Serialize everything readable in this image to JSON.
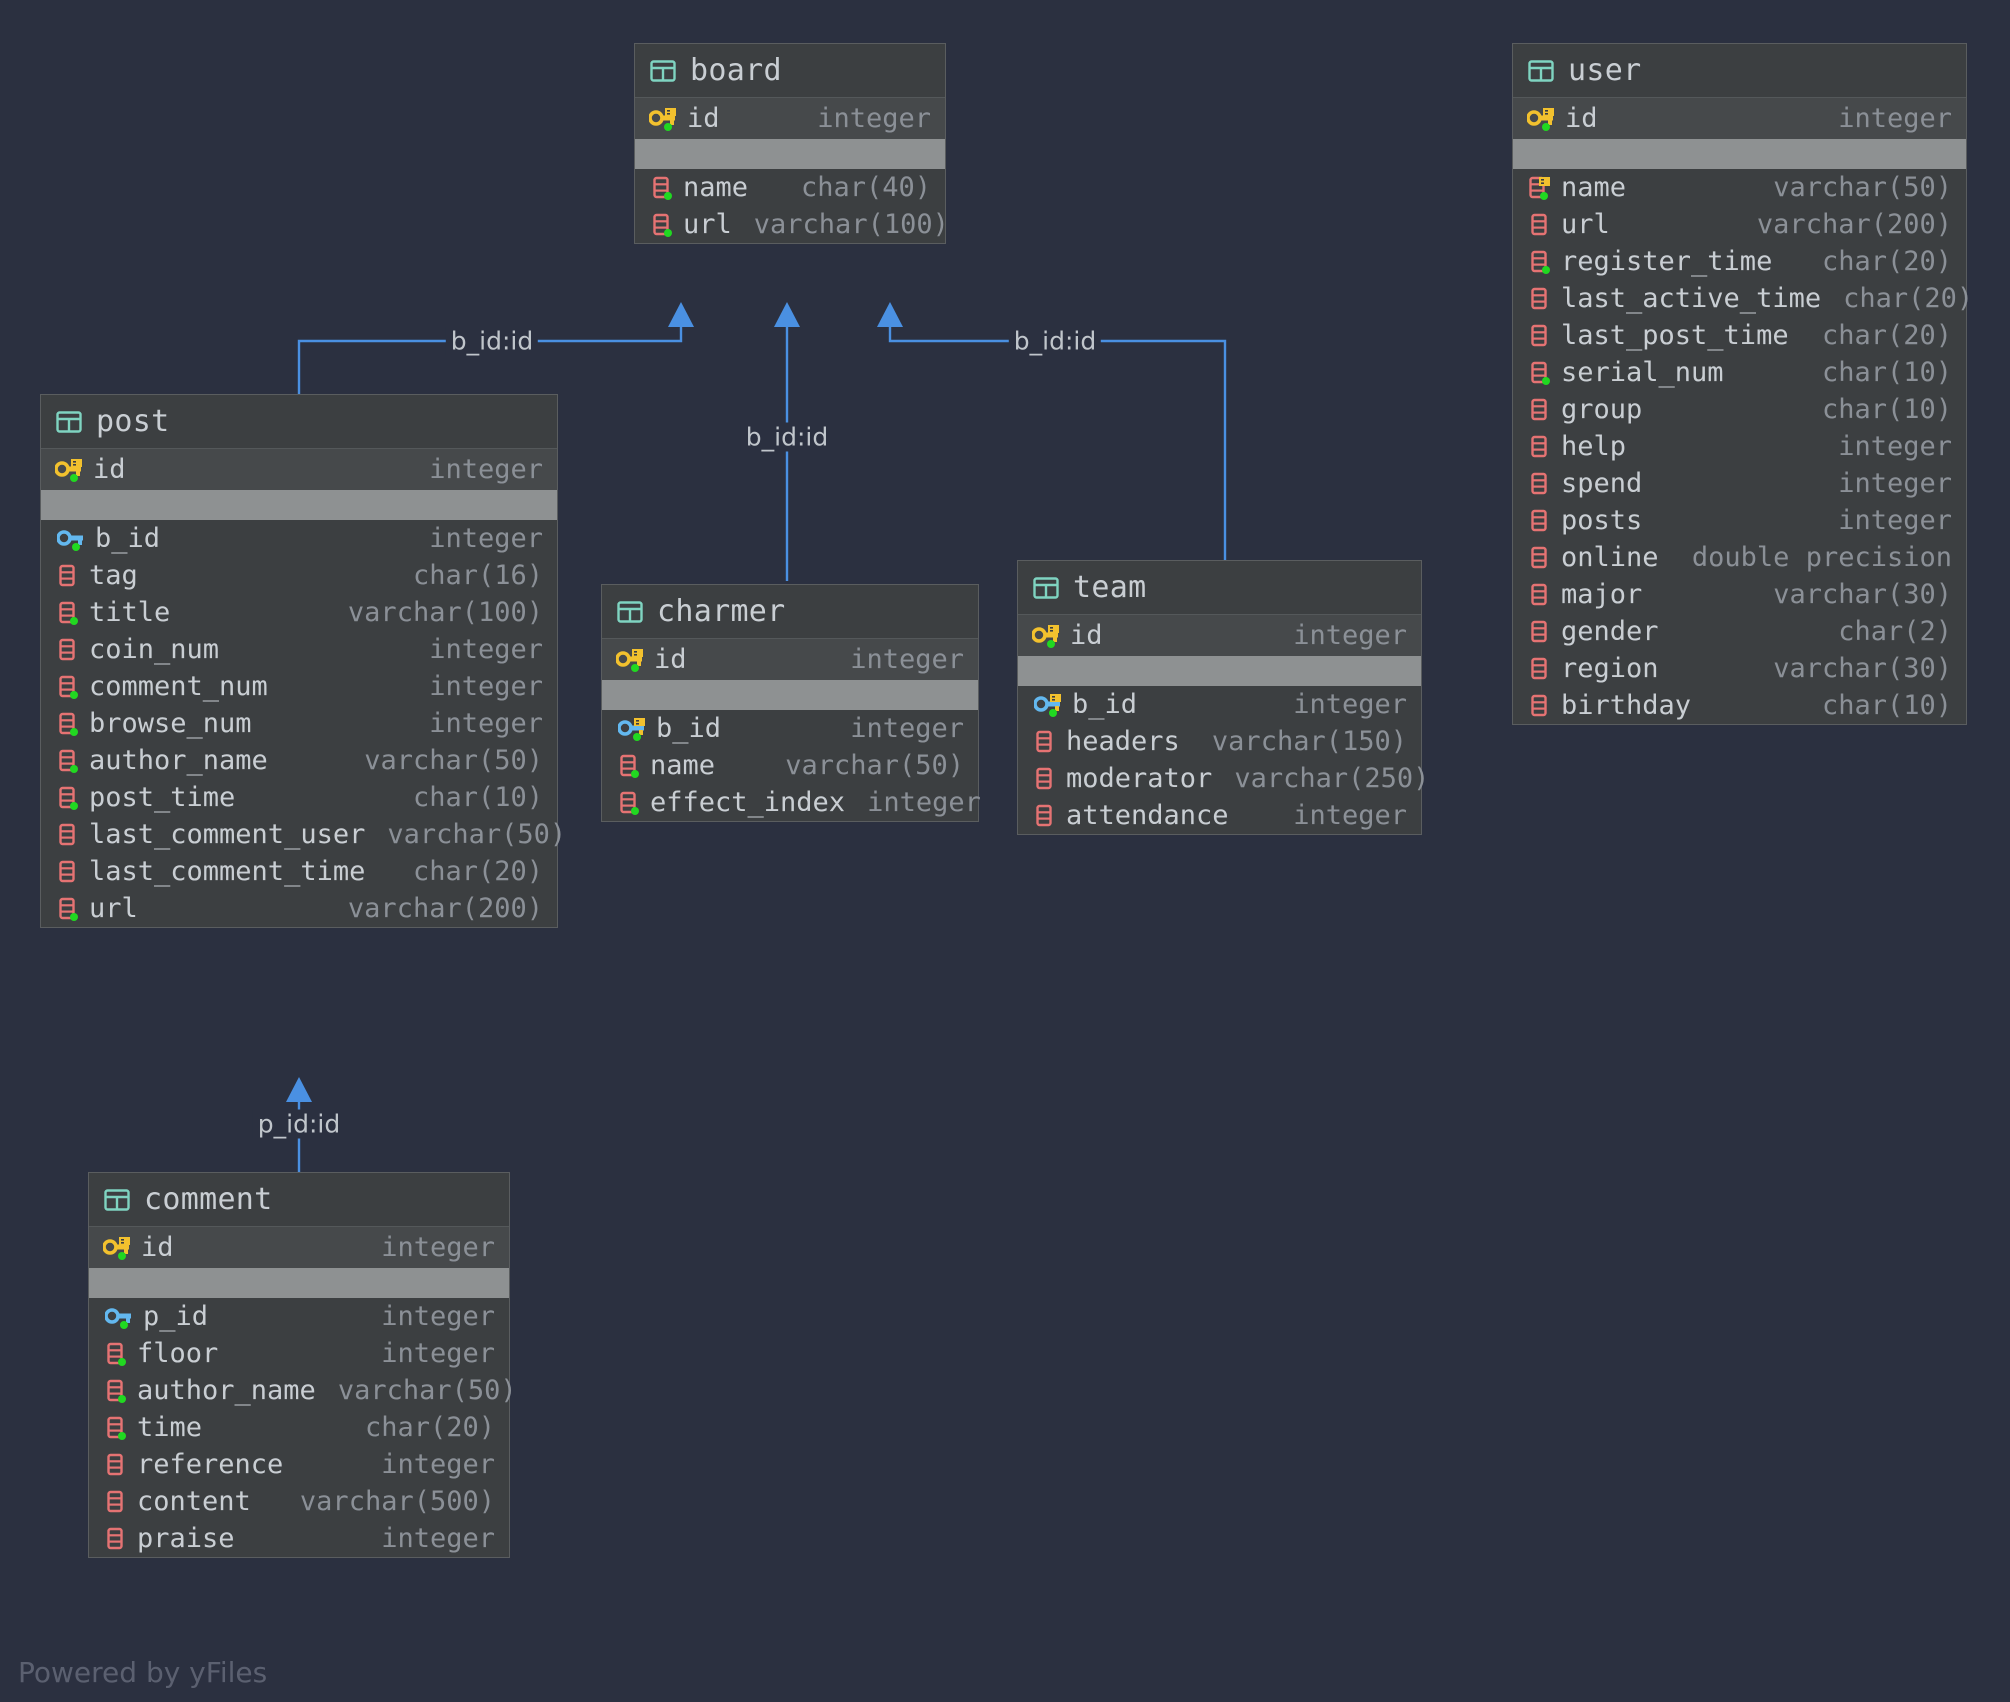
{
  "diagram": {
    "watermark": "Powered by yFiles",
    "accent_edge_color": "#4a90e2",
    "pk_icon_color": "#f2c12e",
    "fk_icon_color": "#63b8ef",
    "column_icon_color": "#e57373",
    "table_icon_color": "#7fd4c1",
    "notnull_dot_color": "#21d821",
    "background": "#2b3040",
    "node_background": "#3c3f41",
    "pk_row_background": "#46494b",
    "divider_background": "#8e9192"
  },
  "tables": [
    {
      "name": "board",
      "icon": "table-icon",
      "pk": {
        "name": "id",
        "type": "integer",
        "icon": "primary-key-icon",
        "not_null": true
      },
      "fields": [
        {
          "name": "name",
          "type": "char(40)",
          "icon": "column-icon",
          "not_null": true
        },
        {
          "name": "url",
          "type": "varchar(100)",
          "icon": "column-icon",
          "not_null": true
        }
      ]
    },
    {
      "name": "user",
      "icon": "table-icon",
      "pk": {
        "name": "id",
        "type": "integer",
        "icon": "primary-key-icon",
        "not_null": true
      },
      "fields": [
        {
          "name": "name",
          "type": "varchar(50)",
          "icon": "column-index-icon",
          "not_null": true
        },
        {
          "name": "url",
          "type": "varchar(200)",
          "icon": "column-icon",
          "not_null": false
        },
        {
          "name": "register_time",
          "type": "char(20)",
          "icon": "column-icon",
          "not_null": true
        },
        {
          "name": "last_active_time",
          "type": "char(20)",
          "icon": "column-icon",
          "not_null": false
        },
        {
          "name": "last_post_time",
          "type": "char(20)",
          "icon": "column-icon",
          "not_null": false
        },
        {
          "name": "serial_num",
          "type": "char(10)",
          "icon": "column-icon",
          "not_null": true
        },
        {
          "name": "group",
          "type": "char(10)",
          "icon": "column-icon",
          "not_null": false
        },
        {
          "name": "help",
          "type": "integer",
          "icon": "column-icon",
          "not_null": false
        },
        {
          "name": "spend",
          "type": "integer",
          "icon": "column-icon",
          "not_null": false
        },
        {
          "name": "posts",
          "type": "integer",
          "icon": "column-icon",
          "not_null": false
        },
        {
          "name": "online",
          "type": "double precision",
          "icon": "column-icon",
          "not_null": false
        },
        {
          "name": "major",
          "type": "varchar(30)",
          "icon": "column-icon",
          "not_null": false
        },
        {
          "name": "gender",
          "type": "char(2)",
          "icon": "column-icon",
          "not_null": false
        },
        {
          "name": "region",
          "type": "varchar(30)",
          "icon": "column-icon",
          "not_null": false
        },
        {
          "name": "birthday",
          "type": "char(10)",
          "icon": "column-icon",
          "not_null": false
        }
      ]
    },
    {
      "name": "post",
      "icon": "table-icon",
      "pk": {
        "name": "id",
        "type": "integer",
        "icon": "primary-key-icon",
        "not_null": true
      },
      "fields": [
        {
          "name": "b_id",
          "type": "integer",
          "icon": "foreign-key-icon",
          "not_null": true
        },
        {
          "name": "tag",
          "type": "char(16)",
          "icon": "column-icon",
          "not_null": false
        },
        {
          "name": "title",
          "type": "varchar(100)",
          "icon": "column-icon",
          "not_null": true
        },
        {
          "name": "coin_num",
          "type": "integer",
          "icon": "column-icon",
          "not_null": false
        },
        {
          "name": "comment_num",
          "type": "integer",
          "icon": "column-icon",
          "not_null": true
        },
        {
          "name": "browse_num",
          "type": "integer",
          "icon": "column-icon",
          "not_null": true
        },
        {
          "name": "author_name",
          "type": "varchar(50)",
          "icon": "column-icon",
          "not_null": true
        },
        {
          "name": "post_time",
          "type": "char(10)",
          "icon": "column-icon",
          "not_null": true
        },
        {
          "name": "last_comment_user",
          "type": "varchar(50)",
          "icon": "column-icon",
          "not_null": false
        },
        {
          "name": "last_comment_time",
          "type": "char(20)",
          "icon": "column-icon",
          "not_null": false
        },
        {
          "name": "url",
          "type": "varchar(200)",
          "icon": "column-icon",
          "not_null": true
        }
      ]
    },
    {
      "name": "charmer",
      "icon": "table-icon",
      "pk": {
        "name": "id",
        "type": "integer",
        "icon": "primary-key-icon",
        "not_null": true
      },
      "fields": [
        {
          "name": "b_id",
          "type": "integer",
          "icon": "foreign-key-index-icon",
          "not_null": true
        },
        {
          "name": "name",
          "type": "varchar(50)",
          "icon": "column-icon",
          "not_null": true
        },
        {
          "name": "effect_index",
          "type": "integer",
          "icon": "column-icon",
          "not_null": true
        }
      ]
    },
    {
      "name": "team",
      "icon": "table-icon",
      "pk": {
        "name": "id",
        "type": "integer",
        "icon": "primary-key-icon",
        "not_null": true
      },
      "fields": [
        {
          "name": "b_id",
          "type": "integer",
          "icon": "foreign-key-index-icon",
          "not_null": true
        },
        {
          "name": "headers",
          "type": "varchar(150)",
          "icon": "column-icon",
          "not_null": false
        },
        {
          "name": "moderator",
          "type": "varchar(250)",
          "icon": "column-icon",
          "not_null": false
        },
        {
          "name": "attendance",
          "type": "integer",
          "icon": "column-icon",
          "not_null": false
        }
      ]
    },
    {
      "name": "comment",
      "icon": "table-icon",
      "pk": {
        "name": "id",
        "type": "integer",
        "icon": "primary-key-icon",
        "not_null": true
      },
      "fields": [
        {
          "name": "p_id",
          "type": "integer",
          "icon": "foreign-key-icon",
          "not_null": true
        },
        {
          "name": "floor",
          "type": "integer",
          "icon": "column-icon",
          "not_null": true
        },
        {
          "name": "author_name",
          "type": "varchar(50)",
          "icon": "column-icon",
          "not_null": true
        },
        {
          "name": "time",
          "type": "char(20)",
          "icon": "column-icon",
          "not_null": true
        },
        {
          "name": "reference",
          "type": "integer",
          "icon": "column-icon",
          "not_null": false
        },
        {
          "name": "content",
          "type": "varchar(500)",
          "icon": "column-icon",
          "not_null": false
        },
        {
          "name": "praise",
          "type": "integer",
          "icon": "column-icon",
          "not_null": false
        }
      ]
    }
  ],
  "relationships": [
    {
      "label": "b_id:id",
      "from": "post",
      "to": "board"
    },
    {
      "label": "b_id:id",
      "from": "charmer",
      "to": "board"
    },
    {
      "label": "b_id:id",
      "from": "team",
      "to": "board"
    },
    {
      "label": "p_id:id",
      "from": "comment",
      "to": "post"
    }
  ]
}
